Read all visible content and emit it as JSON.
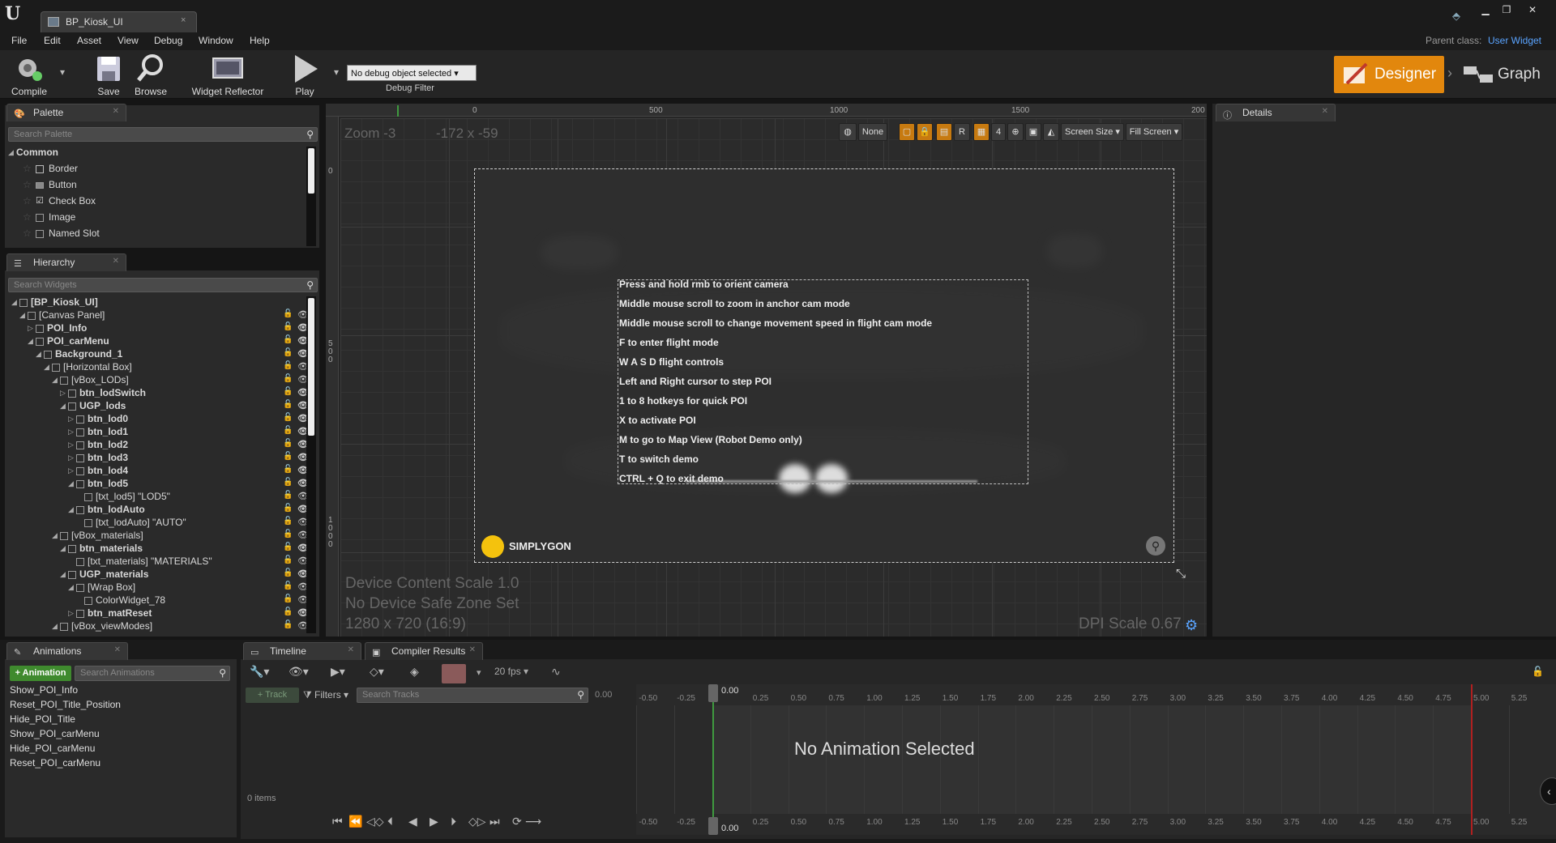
{
  "window": {
    "tab_title": "BP_Kiosk_UI",
    "tab_close": "×",
    "controls": [
      "▁",
      "❐",
      "✕"
    ]
  },
  "menu": [
    "File",
    "Edit",
    "Asset",
    "View",
    "Debug",
    "Window",
    "Help"
  ],
  "parent_class": {
    "label": "Parent class:",
    "value": "User Widget"
  },
  "toolbar": {
    "compile": "Compile",
    "save": "Save",
    "browse": "Browse",
    "widget_reflector": "Widget Reflector",
    "play": "Play",
    "debug_object": "No debug object selected",
    "debug_filter": "Debug Filter",
    "designer": "Designer",
    "graph": "Graph"
  },
  "palette": {
    "tab": "Palette",
    "search_placeholder": "Search Palette",
    "category": "Common",
    "items": [
      "Border",
      "Button",
      "Check Box",
      "Image",
      "Named Slot"
    ]
  },
  "hierarchy": {
    "tab": "Hierarchy",
    "search_placeholder": "Search Widgets",
    "rows": [
      {
        "label": "[BP_Kiosk_UI]",
        "depth": 0,
        "bold": true,
        "toggle": "◢"
      },
      {
        "label": "[Canvas Panel]",
        "depth": 1,
        "bold": false,
        "toggle": "◢"
      },
      {
        "label": "POI_Info",
        "depth": 2,
        "bold": true,
        "toggle": "▷"
      },
      {
        "label": "POI_carMenu",
        "depth": 2,
        "bold": true,
        "toggle": "◢"
      },
      {
        "label": "Background_1",
        "depth": 3,
        "bold": true,
        "toggle": "◢"
      },
      {
        "label": "[Horizontal Box]",
        "depth": 4,
        "bold": false,
        "toggle": "◢"
      },
      {
        "label": "[vBox_LODs]",
        "depth": 5,
        "bold": false,
        "toggle": "◢"
      },
      {
        "label": "btn_lodSwitch",
        "depth": 6,
        "bold": true,
        "toggle": "▷"
      },
      {
        "label": "UGP_lods",
        "depth": 6,
        "bold": true,
        "toggle": "◢"
      },
      {
        "label": "btn_lod0",
        "depth": 7,
        "bold": true,
        "toggle": "▷"
      },
      {
        "label": "btn_lod1",
        "depth": 7,
        "bold": true,
        "toggle": "▷"
      },
      {
        "label": "btn_lod2",
        "depth": 7,
        "bold": true,
        "toggle": "▷"
      },
      {
        "label": "btn_lod3",
        "depth": 7,
        "bold": true,
        "toggle": "▷"
      },
      {
        "label": "btn_lod4",
        "depth": 7,
        "bold": true,
        "toggle": "▷"
      },
      {
        "label": "btn_lod5",
        "depth": 7,
        "bold": true,
        "toggle": "◢"
      },
      {
        "label": "[txt_lod5] \"LOD5\"",
        "depth": 8,
        "bold": false,
        "toggle": ""
      },
      {
        "label": "btn_lodAuto",
        "depth": 7,
        "bold": true,
        "toggle": "◢"
      },
      {
        "label": "[txt_lodAuto] \"AUTO\"",
        "depth": 8,
        "bold": false,
        "toggle": ""
      },
      {
        "label": "[vBox_materials]",
        "depth": 5,
        "bold": false,
        "toggle": "◢"
      },
      {
        "label": "btn_materials",
        "depth": 6,
        "bold": true,
        "toggle": "◢"
      },
      {
        "label": "[txt_materials] \"MATERIALS\"",
        "depth": 7,
        "bold": false,
        "toggle": ""
      },
      {
        "label": "UGP_materials",
        "depth": 6,
        "bold": true,
        "toggle": "◢"
      },
      {
        "label": "[Wrap Box]",
        "depth": 7,
        "bold": false,
        "toggle": "◢"
      },
      {
        "label": "ColorWidget_78",
        "depth": 8,
        "bold": false,
        "toggle": ""
      },
      {
        "label": "btn_matReset",
        "depth": 7,
        "bold": true,
        "toggle": "▷"
      },
      {
        "label": "[vBox_viewModes]",
        "depth": 5,
        "bold": false,
        "toggle": "◢"
      }
    ]
  },
  "viewport": {
    "zoom": "Zoom -3",
    "coords": "-172 x -59",
    "ruler_top": [
      "0",
      "500",
      "1000",
      "1500",
      "200"
    ],
    "ruler_left": [
      "0",
      "5\n0\n0",
      "1\n0\n0\n0"
    ],
    "toolbar": {
      "none": "None",
      "r": "R",
      "four": "4",
      "screen_size": "Screen Size",
      "fill_screen": "Fill Screen"
    },
    "help_lines": [
      "Press and hold rmb to orient camera",
      "Middle mouse scroll to zoom in anchor cam mode",
      "Middle mouse scroll to change movement speed in flight cam mode",
      "F to enter flight mode",
      "W A S D flight controls",
      "Left and Right cursor to step POI",
      "1 to 8 hotkeys for quick POI",
      "X to activate POI",
      "M to go to Map View (Robot Demo only)",
      "T to switch demo",
      "CTRL + Q to exit demo"
    ],
    "logo": "SIMPLYGON",
    "device_scale": "Device Content Scale 1.0",
    "safe_zone": "No Device Safe Zone Set",
    "resolution": "1280 x 720 (16:9)",
    "dpi": "DPI Scale 0.67"
  },
  "details": {
    "tab": "Details"
  },
  "animations": {
    "tab": "Animations",
    "add": "+ Animation",
    "search_placeholder": "Search Animations",
    "items": [
      "Show_POI_Info",
      "Reset_POI_Title_Position",
      "Hide_POI_Title",
      "Show_POI_carMenu",
      "Hide_POI_carMenu",
      "Reset_POI_carMenu"
    ]
  },
  "timeline": {
    "tab": "Timeline",
    "compiler_tab": "Compiler Results",
    "fps": "20 fps",
    "track": "+ Track",
    "filters": "Filters",
    "search_placeholder": "Search Tracks",
    "time_value": "0.00",
    "marker": "0.00",
    "items_count": "0 items",
    "no_anim": "No Animation Selected",
    "ticks": [
      "-0.50",
      "-0.25",
      "0.25",
      "0.50",
      "0.75",
      "1.00",
      "1.25",
      "1.50",
      "1.75",
      "2.00",
      "2.25",
      "2.50",
      "2.75",
      "3.00",
      "3.25",
      "3.50",
      "3.75",
      "4.00",
      "4.25",
      "4.50",
      "4.75",
      "5.00",
      "5.25"
    ]
  },
  "colors": {
    "accent": "#e2870d",
    "link": "#5aa4ff",
    "timeline_green": "#3f9a3f",
    "timeline_red": "#b02020"
  }
}
